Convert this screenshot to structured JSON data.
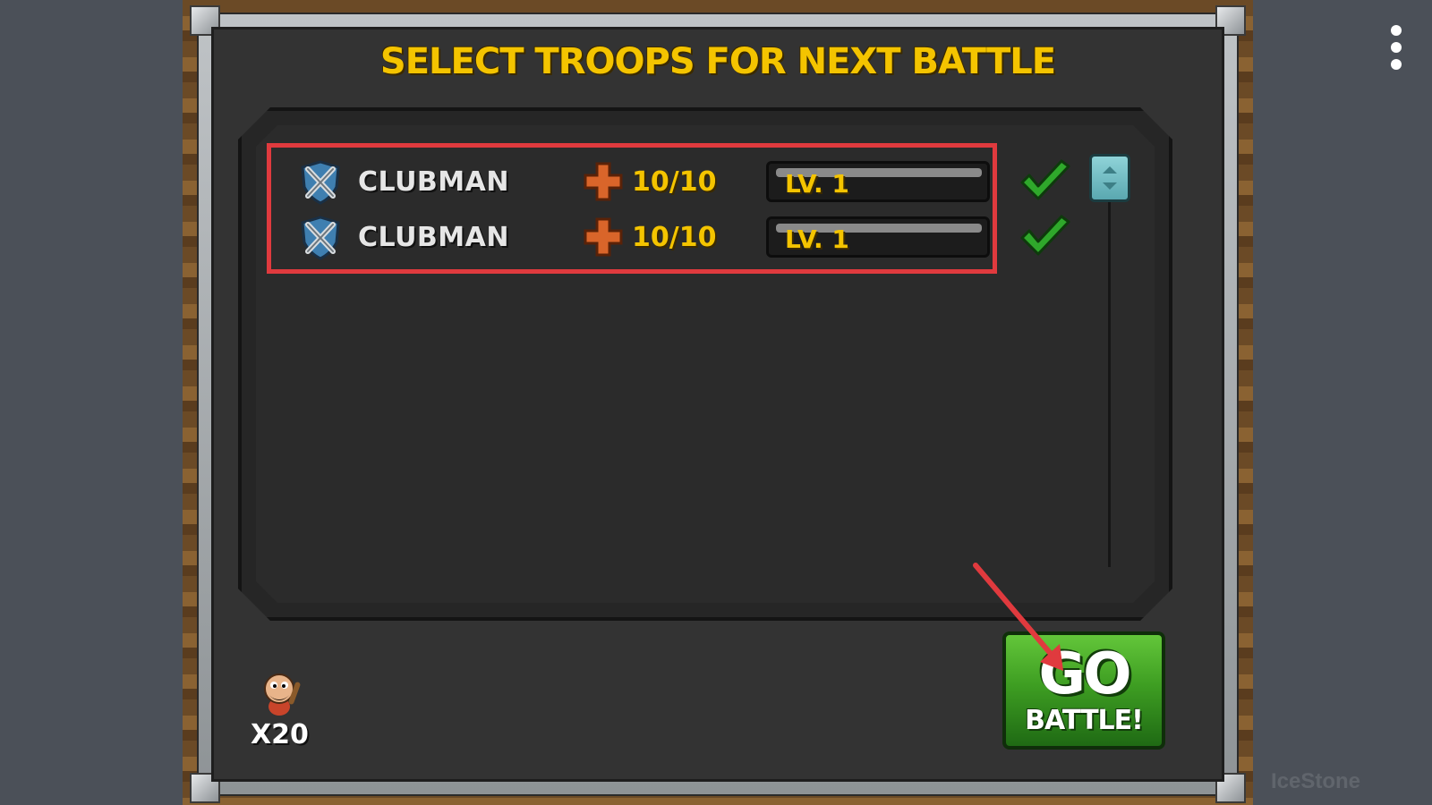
{
  "dialog": {
    "title": "SELECT TROOPS FOR NEXT BATTLE"
  },
  "troops": [
    {
      "name": "CLUBMAN",
      "count": "10/10",
      "level": "LV. 1",
      "selected": true
    },
    {
      "name": "CLUBMAN",
      "count": "10/10",
      "level": "LV. 1",
      "selected": true
    }
  ],
  "reserve": {
    "count_label": "X20"
  },
  "go_button": {
    "line1": "GO",
    "line2": "BATTLE!"
  },
  "watermark": "IceStone",
  "colors": {
    "title": "#f4c400",
    "highlight": "#e03a3e",
    "go_button": "#3e9e22",
    "check": "#2fa82b"
  },
  "icons": {
    "troop_icon": "crossed-swords-shield-icon",
    "heal_icon": "plus-cross-icon",
    "select_icon": "check-icon",
    "menu_icon": "more-vertical-icon"
  }
}
